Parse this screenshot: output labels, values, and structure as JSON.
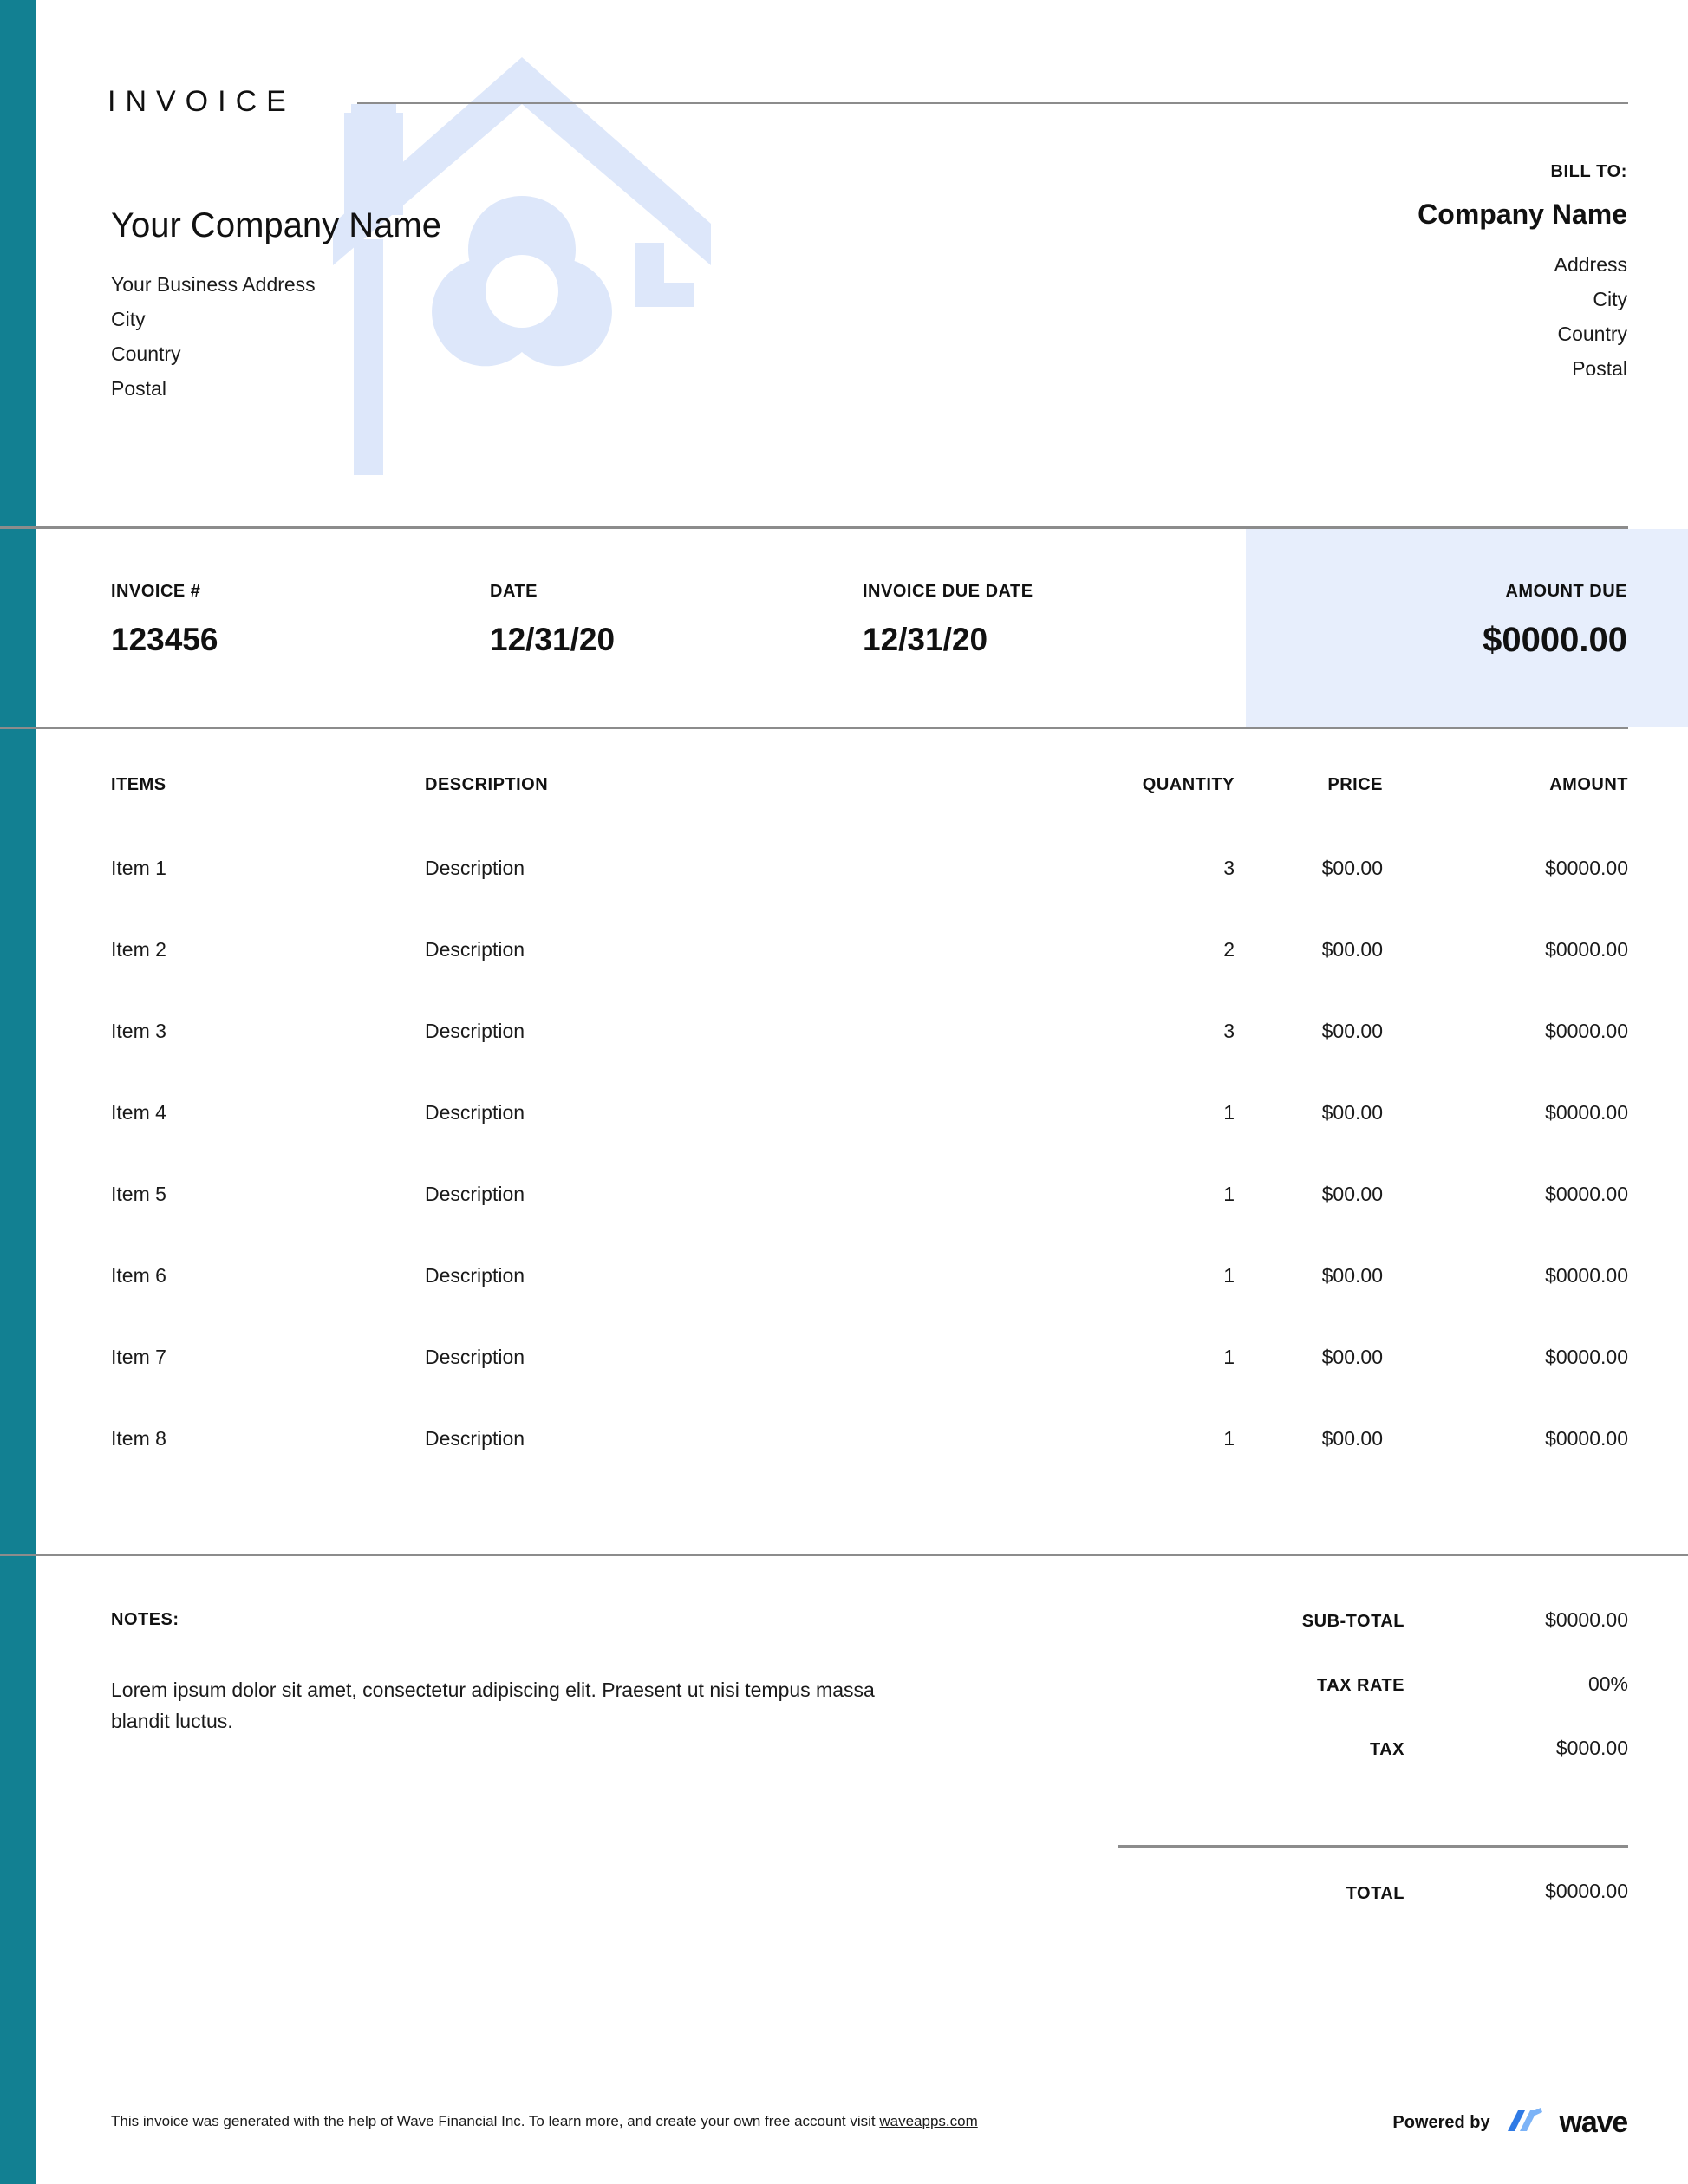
{
  "theme": {
    "accent_teal": "#128092",
    "amount_due_bg": "#e7eefc",
    "rule_gray": "#8c8c8c",
    "watermark_blue": "#dde7fa",
    "wave_blue_light": "#7cb3f7",
    "wave_blue_dark": "#2f7ae5"
  },
  "header": {
    "title": "INVOICE",
    "seller": {
      "name": "Your Company Name",
      "lines": [
        "Your Business Address",
        "City",
        "Country",
        "Postal"
      ]
    },
    "bill_to": {
      "label": "BILL TO:",
      "name": "Company Name",
      "lines": [
        "Address",
        "City",
        "Country",
        "Postal"
      ]
    },
    "watermark_icon": "house-with-fan-watermark"
  },
  "meta": {
    "invoice_no": {
      "label": "INVOICE #",
      "value": "123456"
    },
    "date": {
      "label": "DATE",
      "value": "12/31/20"
    },
    "due_date": {
      "label": "INVOICE DUE DATE",
      "value": "12/31/20"
    },
    "amount_due": {
      "label": "AMOUNT DUE",
      "value": "$0000.00"
    }
  },
  "items": {
    "columns": [
      "ITEMS",
      "DESCRIPTION",
      "QUANTITY",
      "PRICE",
      "AMOUNT"
    ],
    "rows": [
      {
        "item": "Item 1",
        "description": "Description",
        "quantity": "3",
        "price": "$00.00",
        "amount": "$0000.00"
      },
      {
        "item": "Item 2",
        "description": "Description",
        "quantity": "2",
        "price": "$00.00",
        "amount": "$0000.00"
      },
      {
        "item": "Item 3",
        "description": "Description",
        "quantity": "3",
        "price": "$00.00",
        "amount": "$0000.00"
      },
      {
        "item": "Item 4",
        "description": "Description",
        "quantity": "1",
        "price": "$00.00",
        "amount": "$0000.00"
      },
      {
        "item": "Item 5",
        "description": "Description",
        "quantity": "1",
        "price": "$00.00",
        "amount": "$0000.00"
      },
      {
        "item": "Item 6",
        "description": "Description",
        "quantity": "1",
        "price": "$00.00",
        "amount": "$0000.00"
      },
      {
        "item": "Item 7",
        "description": "Description",
        "quantity": "1",
        "price": "$00.00",
        "amount": "$0000.00"
      },
      {
        "item": "Item 8",
        "description": "Description",
        "quantity": "1",
        "price": "$00.00",
        "amount": "$0000.00"
      }
    ]
  },
  "notes": {
    "label": "NOTES:",
    "body": "Lorem ipsum dolor sit amet, consectetur adipiscing elit. Praesent ut nisi tempus massa blandit luctus."
  },
  "totals": {
    "sub_total": {
      "label": "SUB-TOTAL",
      "value": "$0000.00"
    },
    "tax_rate": {
      "label": "TAX RATE",
      "value": "00%"
    },
    "tax": {
      "label": "TAX",
      "value": "$000.00"
    },
    "total": {
      "label": "TOTAL",
      "value": "$0000.00"
    }
  },
  "footer": {
    "note_before_link": "This invoice was generated with the help of Wave Financial Inc. To learn more, and create your own free account visit ",
    "link_text": "waveapps.com",
    "powered_by_label": "Powered by",
    "wave_wordmark": "wave",
    "wave_logo_icon": "wave-logo-icon"
  }
}
